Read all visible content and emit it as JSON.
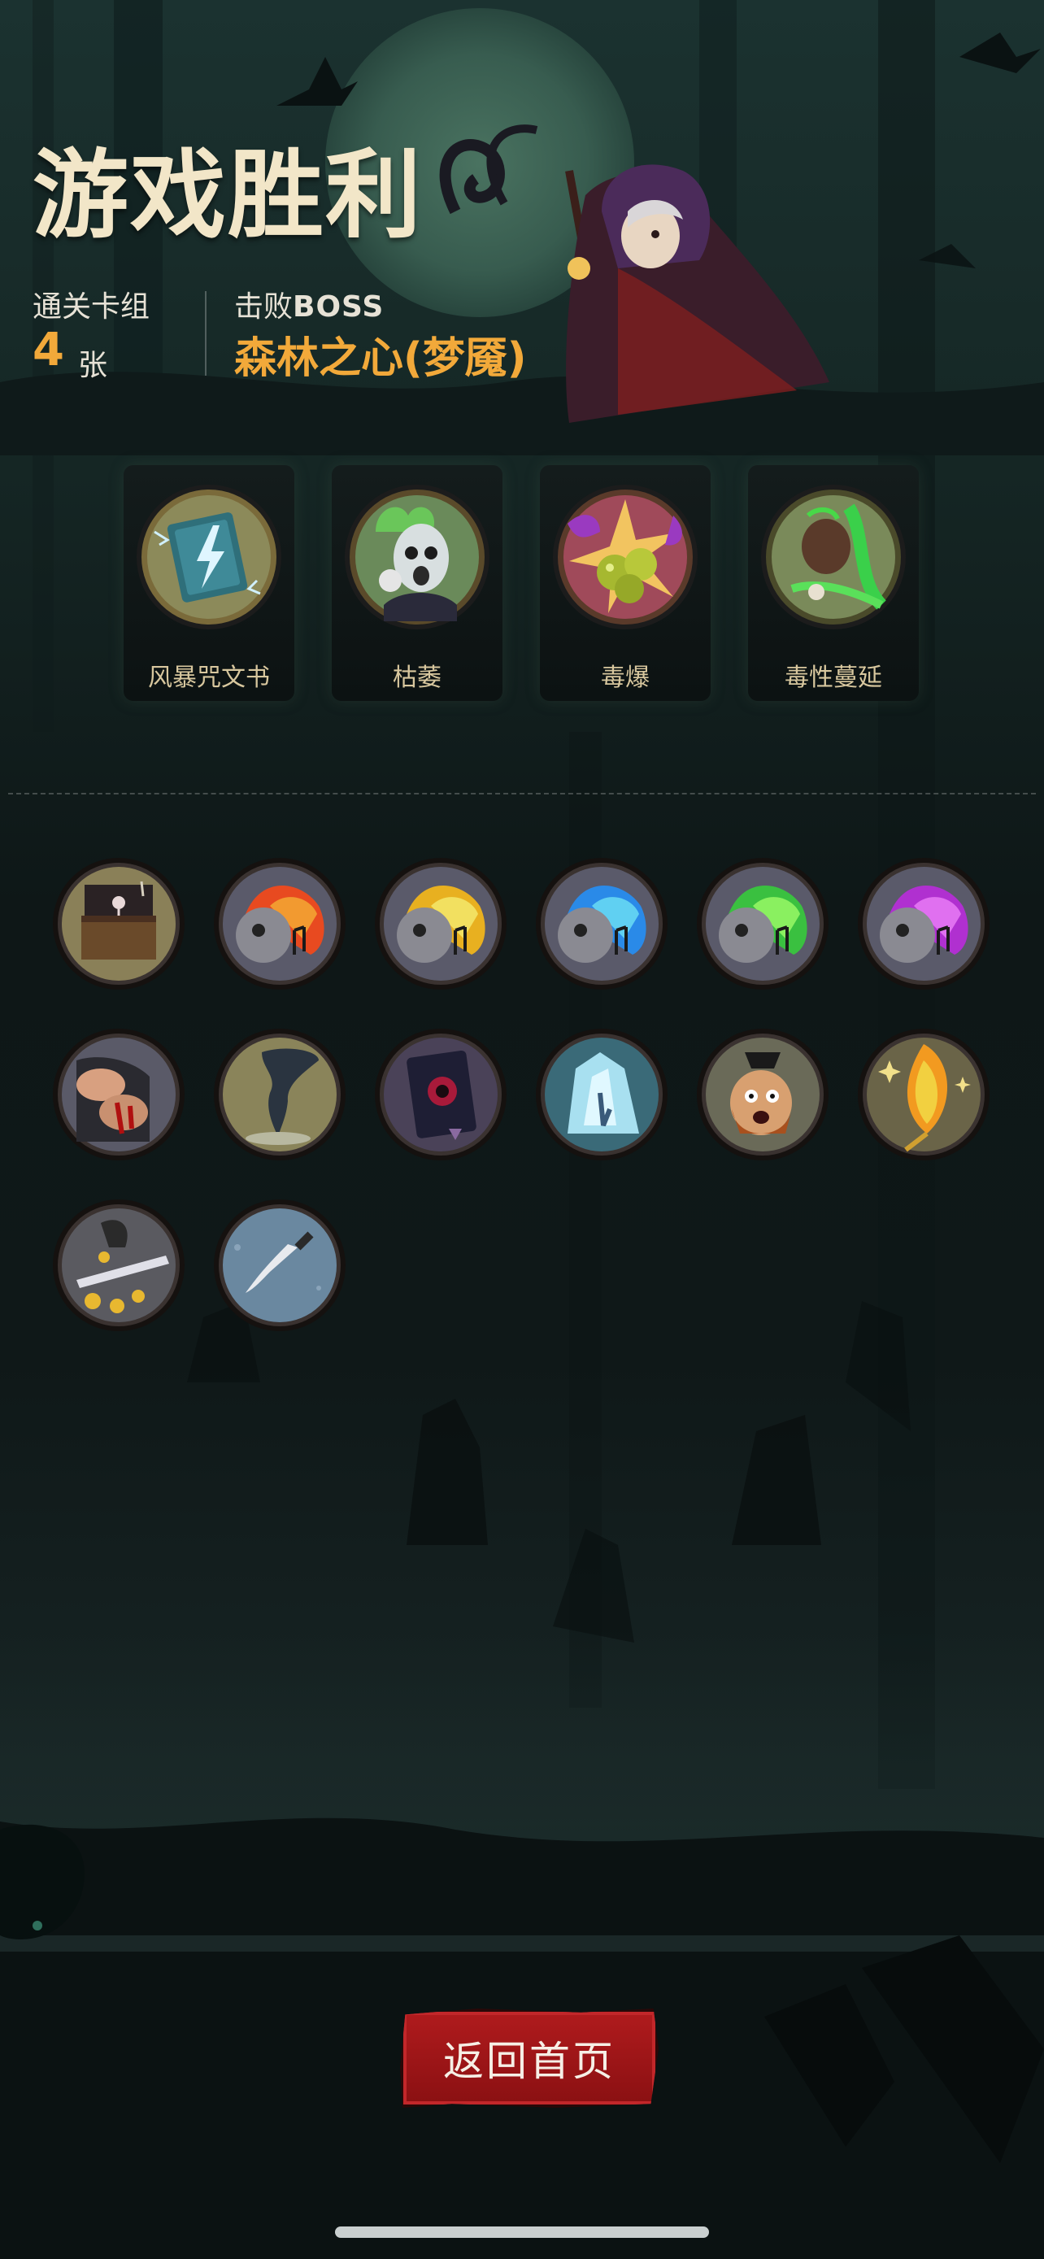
{
  "result": {
    "title": "游戏胜利",
    "deck_label": "通关卡组",
    "deck_count": "4",
    "deck_unit": "张",
    "boss_label_prefix": "击败",
    "boss_label_suffix": "BOSS",
    "boss_name": "森林之心(梦魇)"
  },
  "skills": [
    {
      "label": "风暴咒文书",
      "icon": "storm-spellbook-icon"
    },
    {
      "label": "枯萎",
      "icon": "wither-ghost-icon"
    },
    {
      "label": "毒爆",
      "icon": "poison-burst-icon"
    },
    {
      "label": "毒性蔓延",
      "icon": "toxic-spread-icon"
    }
  ],
  "relics": [
    {
      "icon": "music-box-icon"
    },
    {
      "icon": "red-flame-music-skull-icon"
    },
    {
      "icon": "yellow-flame-music-skull-icon"
    },
    {
      "icon": "blue-flame-music-skull-icon"
    },
    {
      "icon": "green-flame-music-skull-icon"
    },
    {
      "icon": "purple-flame-music-skull-icon"
    },
    {
      "icon": "bloody-fist-brawler-icon"
    },
    {
      "icon": "tornado-icon"
    },
    {
      "icon": "dark-tome-icon"
    },
    {
      "icon": "ice-crystal-icon"
    },
    {
      "icon": "panicked-pirate-icon"
    },
    {
      "icon": "phoenix-feather-icon"
    },
    {
      "icon": "gold-coin-sword-icon"
    },
    {
      "icon": "throwing-knife-icon"
    }
  ],
  "footer": {
    "return_label": "返回首页"
  },
  "colors": {
    "accent_orange": "#f2a93a",
    "title_cream": "#f2e6c8",
    "button_red": "#b01b1d",
    "skill_label": "#d8c79e"
  }
}
